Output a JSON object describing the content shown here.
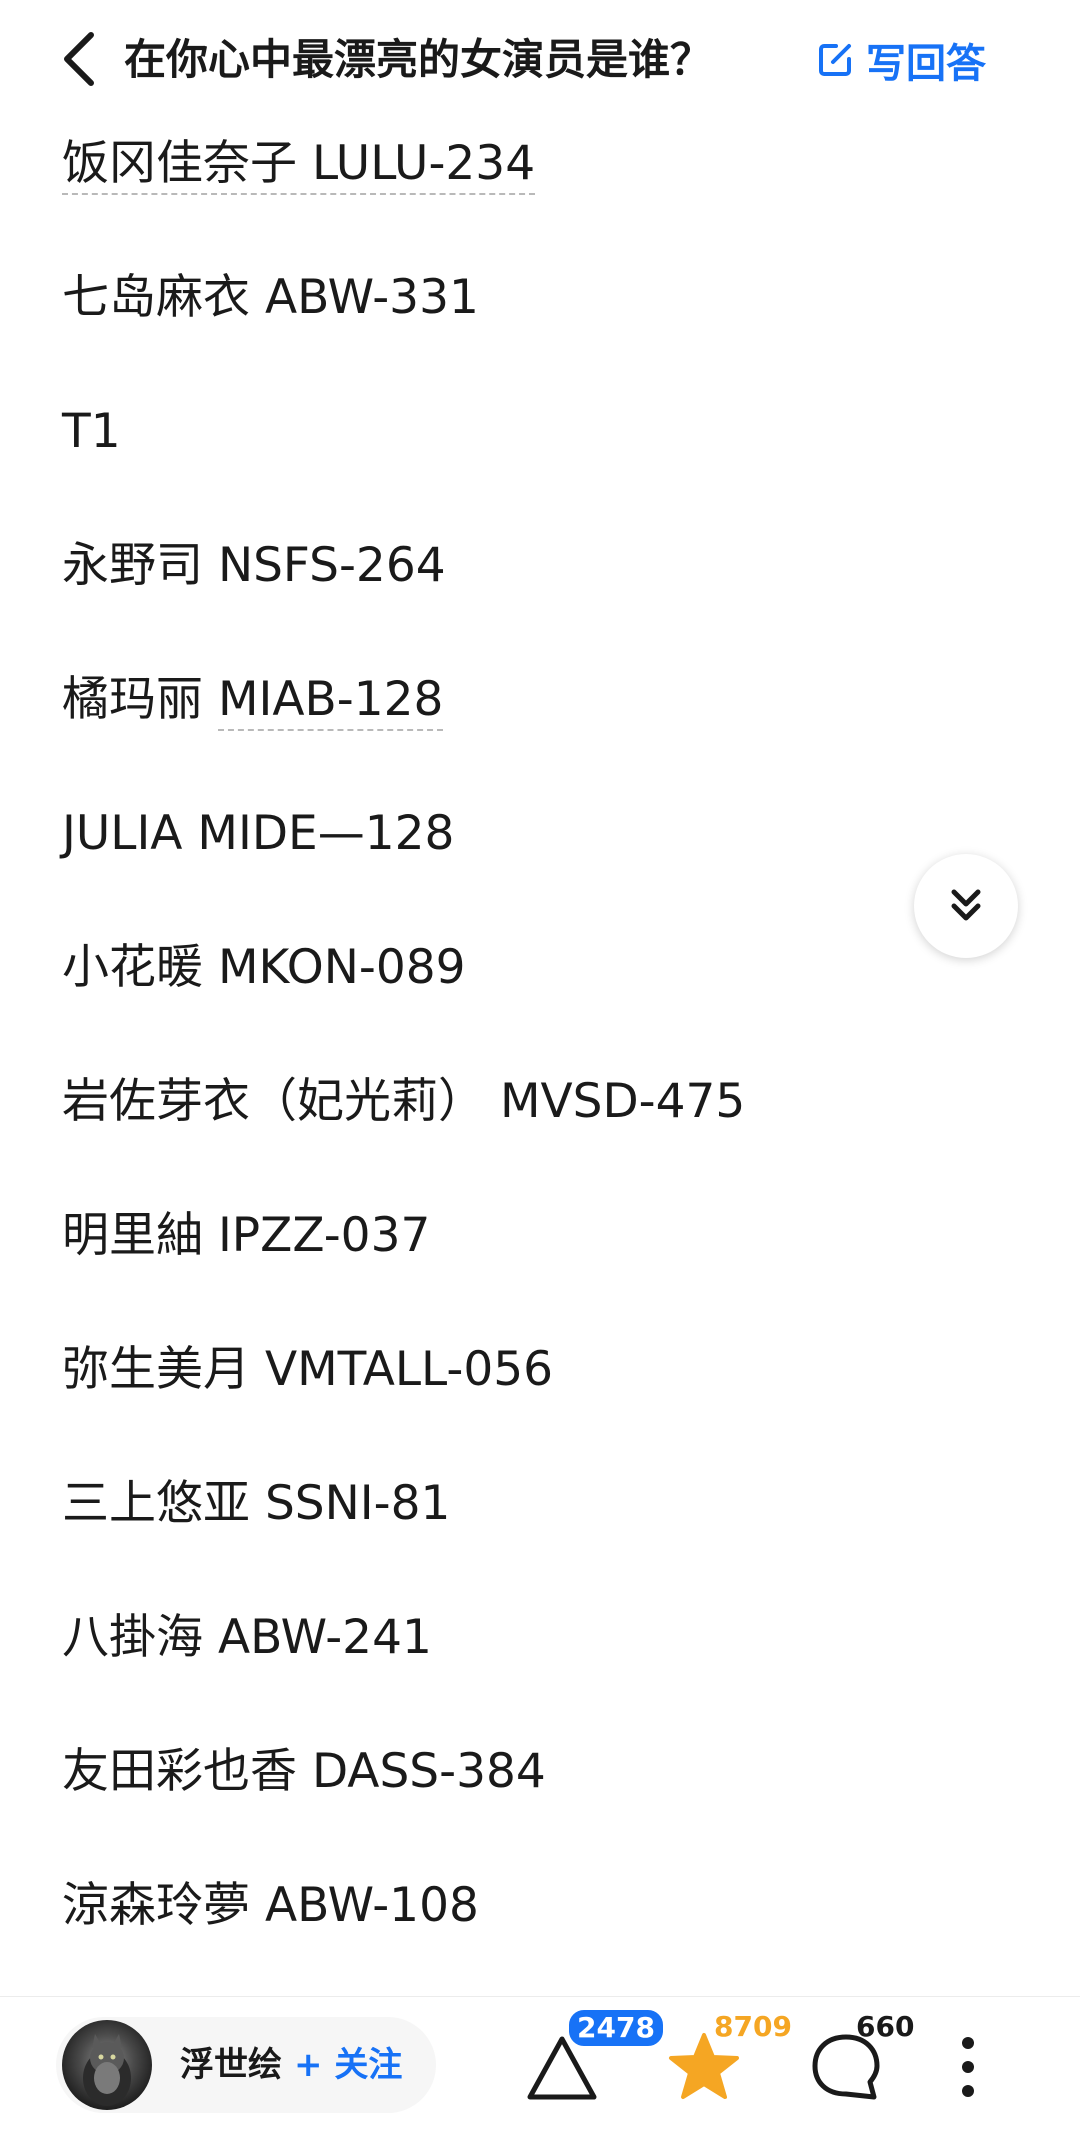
{
  "header": {
    "title": "在你心中最漂亮的女演员是谁？",
    "write_answer_label": "写回答"
  },
  "answer_lines": [
    "饭冈佳奈子 LULU-234",
    "七岛麻衣 ABW-331",
    "T1",
    "永野司 NSFS-264",
    "橘玛丽 MIAB-128",
    "JULIA MIDE—128",
    "小花暖 MKON-089",
    "岩佐芽衣（妃光莉） MVSD-475",
    "明里紬 IPZZ-037",
    "弥生美月 VMTALL-056",
    "三上悠亚 SSNI-81",
    "八掛海 ABW-241",
    "友田彩也香 DASS-384",
    "涼森玲夢 ABW-108"
  ],
  "line_parts": {
    "line0_name": "饭冈佳奈子 ",
    "line0_code": "LULU-234",
    "line4_name": "橘玛丽 ",
    "line4_code": "MIAB-128"
  },
  "bottom_bar": {
    "author_name": "浮世绘",
    "follow_label": "+ 关注",
    "vote_count": "2478",
    "favorite_count": "8709",
    "comment_count": "660"
  },
  "colors": {
    "accent": "#1772f6",
    "favorite": "#f5a623",
    "text": "#1a1a1a"
  },
  "icons": {
    "back": "back-chevron-icon",
    "write": "edit-icon",
    "scroll": "double-chevron-down-icon",
    "vote": "triangle-upvote-icon",
    "favorite": "star-icon",
    "comment": "comment-bubble-icon",
    "more": "more-vertical-icon"
  }
}
